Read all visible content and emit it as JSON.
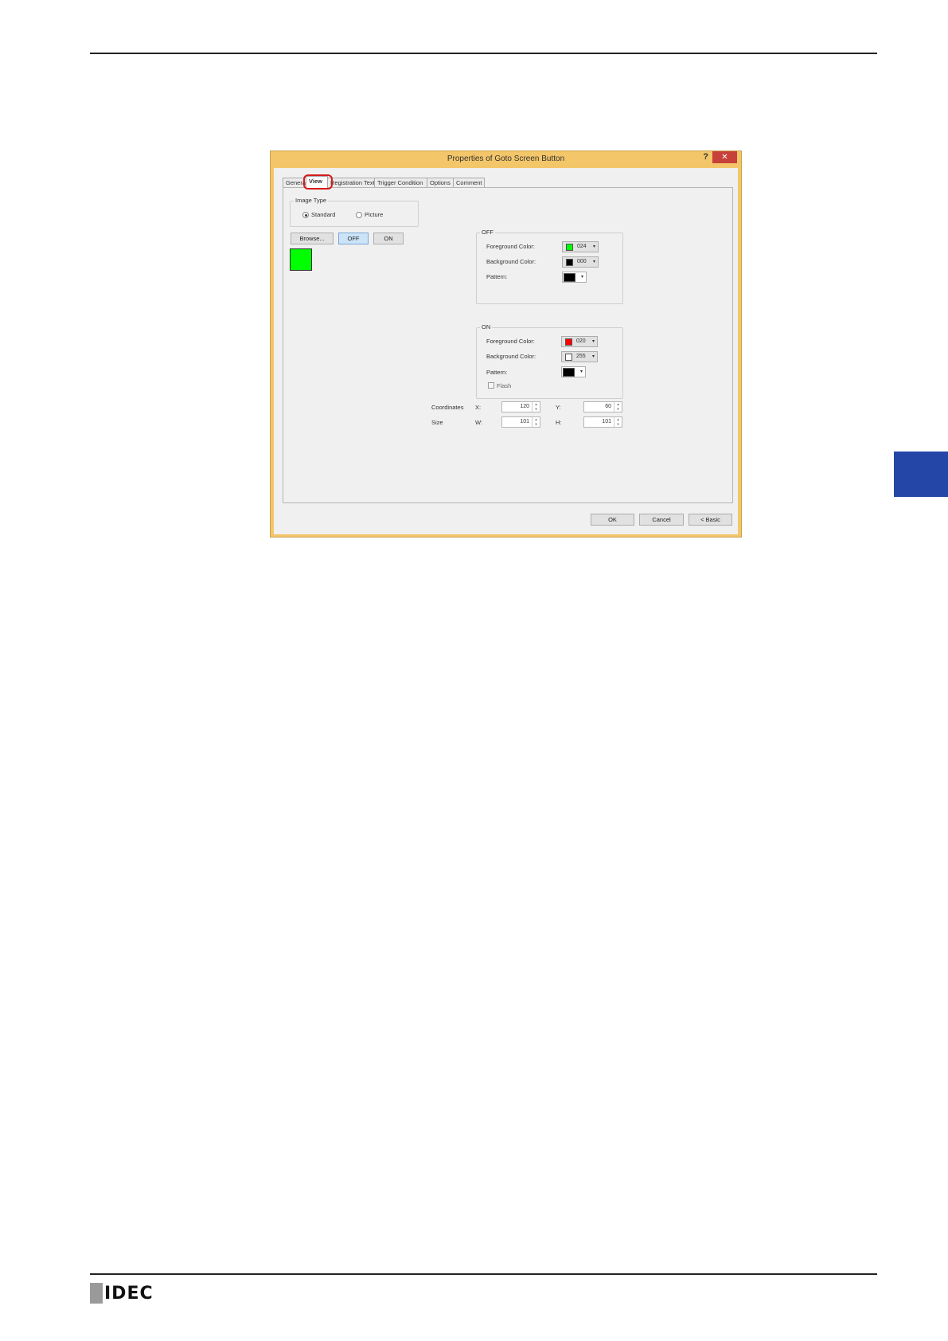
{
  "dialog": {
    "title": "Properties of Goto Screen Button",
    "help": "?",
    "close": "✕",
    "tabs": [
      "General",
      "View",
      "Registration Text",
      "Trigger Condition",
      "Options",
      "Comment"
    ],
    "active_tab": "View"
  },
  "image_type": {
    "label": "Image Type",
    "options": [
      "Standard",
      "Picture"
    ],
    "selected": "Standard"
  },
  "buttons": {
    "browse": "Browse...",
    "off": "OFF",
    "on": "ON",
    "ok": "OK",
    "cancel": "Cancel",
    "basic": "< Basic"
  },
  "off_group": {
    "label": "OFF",
    "fg_label": "Foreground Color:",
    "fg_value": "024",
    "fg_color": "#00ff00",
    "bg_label": "Background Color:",
    "bg_value": "000",
    "bg_color": "#000000",
    "pattern_label": "Pattern:",
    "pattern_color": "#000000"
  },
  "on_group": {
    "label": "ON",
    "fg_label": "Foreground Color:",
    "fg_value": "020",
    "fg_color": "#ff0000",
    "bg_label": "Background Color:",
    "bg_value": "255",
    "bg_color": "#ffffff",
    "pattern_label": "Pattern:",
    "pattern_color": "#000000",
    "flash_label": "Flash"
  },
  "coordinates": {
    "label": "Coordinates",
    "x_label": "X:",
    "x": "120",
    "y_label": "Y:",
    "y": "60"
  },
  "size": {
    "label": "Size",
    "w_label": "W:",
    "w": "101",
    "h_label": "H:",
    "h": "101"
  },
  "footer": {
    "logo": "IDEC"
  },
  "colors": {
    "side_tab": "#2446a7",
    "dialog_frame": "#f3c669",
    "highlight": "#d61c1c",
    "preview": "#00ff00"
  }
}
